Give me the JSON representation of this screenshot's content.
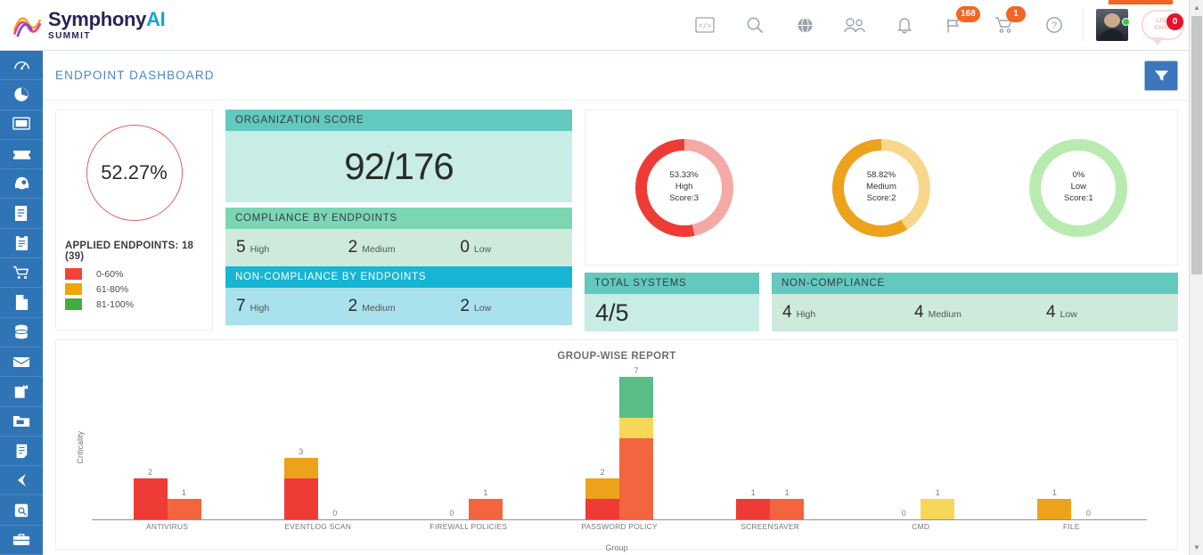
{
  "brand": {
    "name_main": "Symphony",
    "name_accent": "AI",
    "sub": "SUMMIT"
  },
  "topbar": {
    "icons": [
      {
        "name": "code-icon",
        "label": "code"
      },
      {
        "name": "search-icon",
        "label": "search"
      },
      {
        "name": "globe-icon",
        "label": "globe"
      },
      {
        "name": "users-icon",
        "label": "users"
      },
      {
        "name": "bell-icon",
        "label": "notifications"
      },
      {
        "name": "announcement-icon",
        "label": "announcements",
        "badge": "168"
      },
      {
        "name": "cart-icon",
        "label": "cart",
        "badge": "1"
      },
      {
        "name": "help-icon",
        "label": "help"
      }
    ],
    "live_chat": {
      "line1": "LIVE",
      "line2": "CHAT",
      "badge": "0"
    }
  },
  "sidebar": {
    "items": [
      {
        "name": "sidebar-item-dashboard",
        "icon": "gauge-icon"
      },
      {
        "name": "sidebar-item-analytics",
        "icon": "pie-chart-icon"
      },
      {
        "name": "sidebar-item-monitor",
        "icon": "monitor-icon"
      },
      {
        "name": "sidebar-item-tickets",
        "icon": "ticket-icon"
      },
      {
        "name": "sidebar-item-support",
        "icon": "headset-icon"
      },
      {
        "name": "sidebar-item-reports",
        "icon": "report-icon"
      },
      {
        "name": "sidebar-item-tasks",
        "icon": "clipboard-icon"
      },
      {
        "name": "sidebar-item-procurement",
        "icon": "cart-icon"
      },
      {
        "name": "sidebar-item-documents",
        "icon": "document-icon"
      },
      {
        "name": "sidebar-item-database",
        "icon": "database-icon"
      },
      {
        "name": "sidebar-item-inbox",
        "icon": "inbox-icon"
      },
      {
        "name": "sidebar-item-projects",
        "icon": "project-icon"
      },
      {
        "name": "sidebar-item-folder",
        "icon": "folder-icon"
      },
      {
        "name": "sidebar-item-notes",
        "icon": "notes-icon"
      },
      {
        "name": "sidebar-item-bookmark",
        "icon": "bookmark-icon"
      },
      {
        "name": "sidebar-item-settings",
        "icon": "settings-icon"
      },
      {
        "name": "sidebar-item-briefcase",
        "icon": "briefcase-icon"
      }
    ]
  },
  "page": {
    "title": "ENDPOINT DASHBOARD",
    "filter_icon": "filter-icon"
  },
  "applied": {
    "percent": "52.27%",
    "label": "APPLIED ENDPOINTS: 18 (39)",
    "legend": [
      {
        "range": "0-60%",
        "color": "#f44336"
      },
      {
        "range": "61-80%",
        "color": "#f0a500"
      },
      {
        "range": "81-100%",
        "color": "#3fae3f"
      }
    ]
  },
  "organization_score": {
    "title": "ORGANIZATION SCORE",
    "value": "92/176"
  },
  "compliance_by_endpoints": {
    "title": "COMPLIANCE BY ENDPOINTS",
    "items": [
      {
        "value": "5",
        "label": "High"
      },
      {
        "value": "2",
        "label": "Medium"
      },
      {
        "value": "0",
        "label": "Low"
      }
    ]
  },
  "non_compliance_by_endpoints": {
    "title": "NON-COMPLIANCE BY ENDPOINTS",
    "items": [
      {
        "value": "7",
        "label": "High"
      },
      {
        "value": "2",
        "label": "Medium"
      },
      {
        "value": "2",
        "label": "Low"
      }
    ]
  },
  "severity_donuts": [
    {
      "percent": "53.33%",
      "level": "High",
      "score": "Score:3",
      "color": "#ef3b36",
      "track": "#f5a9a6",
      "pct_value": 53.33
    },
    {
      "percent": "58.82%",
      "level": "Medium",
      "score": "Score:2",
      "color": "#eda21c",
      "track": "#f7d78b",
      "pct_value": 58.82
    },
    {
      "percent": "0%",
      "level": "Low",
      "score": "Score:1",
      "color": "#b9eab0",
      "track": "#b9eab0",
      "pct_value": 0
    }
  ],
  "total_systems": {
    "title": "TOTAL SYSTEMS",
    "value": "4/5"
  },
  "non_compliance": {
    "title": "NON-COMPLIANCE",
    "items": [
      {
        "value": "4",
        "label": "High"
      },
      {
        "value": "4",
        "label": "Medium"
      },
      {
        "value": "4",
        "label": "Low"
      }
    ]
  },
  "chart_data": {
    "type": "bar",
    "title": "GROUP-WISE REPORT",
    "xlabel": "Group",
    "ylabel": "Criticality",
    "stacked": true,
    "grid": false,
    "legend_position": "none",
    "ylim": [
      0,
      7
    ],
    "colors": {
      "red": "#ef3b36",
      "orange_red": "#f2653f",
      "orange": "#eda21c",
      "yellow": "#f7d757",
      "green": "#5bbd86"
    },
    "categories": [
      "ANTIVIRUS",
      "EVENTLOG SCAN",
      "FIREWALL POLICIES",
      "PASSWORD POLICY",
      "SCREENSAVER",
      "CMD",
      "FILE"
    ],
    "groups": [
      {
        "category": "ANTIVIRUS",
        "bars": [
          {
            "total": 2,
            "label": "2",
            "segments": [
              {
                "color": "#ef3b36",
                "value": 2
              }
            ]
          },
          {
            "total": 1,
            "label": "1",
            "segments": [
              {
                "color": "#f2653f",
                "value": 1
              }
            ]
          }
        ]
      },
      {
        "category": "EVENTLOG SCAN",
        "bars": [
          {
            "total": 3,
            "label": "3",
            "segments": [
              {
                "color": "#ef3b36",
                "value": 2
              },
              {
                "color": "#eda21c",
                "value": 1
              }
            ]
          },
          {
            "total": 0,
            "label": "0",
            "segments": []
          }
        ]
      },
      {
        "category": "FIREWALL POLICIES",
        "bars": [
          {
            "total": 0,
            "label": "0",
            "segments": []
          },
          {
            "total": 1,
            "label": "1",
            "segments": [
              {
                "color": "#f2653f",
                "value": 1
              }
            ]
          }
        ]
      },
      {
        "category": "PASSWORD POLICY",
        "bars": [
          {
            "total": 2,
            "label": "2",
            "segments": [
              {
                "color": "#ef3b36",
                "value": 1
              },
              {
                "color": "#eda21c",
                "value": 1
              }
            ]
          },
          {
            "total": 7,
            "label": "7",
            "segments": [
              {
                "color": "#f2653f",
                "value": 4
              },
              {
                "color": "#f7d757",
                "value": 1
              },
              {
                "color": "#5bbd86",
                "value": 2
              }
            ]
          }
        ]
      },
      {
        "category": "SCREENSAVER",
        "bars": [
          {
            "total": 1,
            "label": "1",
            "segments": [
              {
                "color": "#ef3b36",
                "value": 1
              }
            ]
          },
          {
            "total": 1,
            "label": "1",
            "segments": [
              {
                "color": "#f2653f",
                "value": 1
              }
            ]
          }
        ]
      },
      {
        "category": "CMD",
        "bars": [
          {
            "total": 0,
            "label": "0",
            "segments": []
          },
          {
            "total": 1,
            "label": "1",
            "segments": [
              {
                "color": "#f7d757",
                "value": 1
              }
            ]
          }
        ]
      },
      {
        "category": "FILE",
        "bars": [
          {
            "total": 1,
            "label": "1",
            "segments": [
              {
                "color": "#eda21c",
                "value": 1
              }
            ]
          },
          {
            "total": 0,
            "label": "0",
            "segments": []
          }
        ]
      }
    ]
  }
}
